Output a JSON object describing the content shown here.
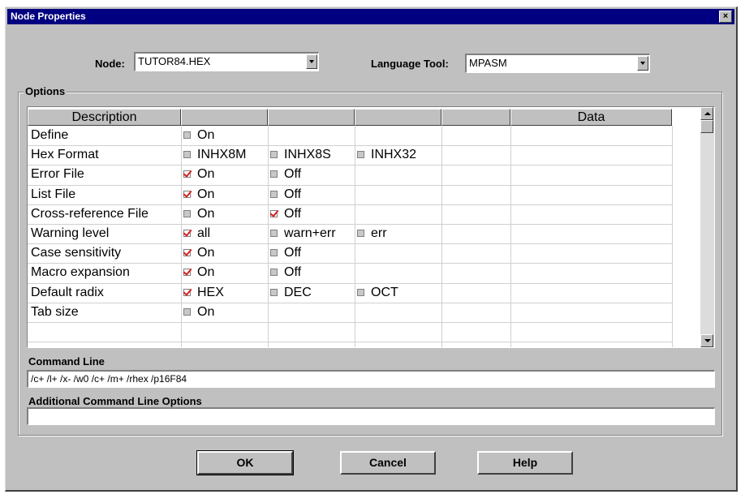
{
  "window": {
    "title": "Node Properties",
    "close_glyph": "×"
  },
  "node": {
    "label": "Node:",
    "value": "TUTOR84.HEX"
  },
  "language_tool": {
    "label": "Language Tool:",
    "value": "MPASM"
  },
  "options": {
    "group_label": "Options",
    "headers": [
      "Description",
      "",
      "",
      "",
      "Data"
    ],
    "rows": [
      {
        "description": "Define",
        "opts": [
          {
            "label": "On",
            "checked": false
          }
        ]
      },
      {
        "description": "Hex Format",
        "opts": [
          {
            "label": "INHX8M",
            "checked": false
          },
          {
            "label": "INHX8S",
            "checked": false
          },
          {
            "label": "INHX32",
            "checked": false
          }
        ]
      },
      {
        "description": "Error File",
        "opts": [
          {
            "label": "On",
            "checked": true
          },
          {
            "label": "Off",
            "checked": false
          }
        ]
      },
      {
        "description": "List File",
        "opts": [
          {
            "label": "On",
            "checked": true
          },
          {
            "label": "Off",
            "checked": false
          }
        ]
      },
      {
        "description": "Cross-reference File",
        "opts": [
          {
            "label": "On",
            "checked": false
          },
          {
            "label": "Off",
            "checked": true
          }
        ]
      },
      {
        "description": "Warning level",
        "opts": [
          {
            "label": "all",
            "checked": true
          },
          {
            "label": "warn+err",
            "checked": false
          },
          {
            "label": "err",
            "checked": false
          }
        ]
      },
      {
        "description": "Case sensitivity",
        "opts": [
          {
            "label": "On",
            "checked": true
          },
          {
            "label": "Off",
            "checked": false
          }
        ]
      },
      {
        "description": "Macro expansion",
        "opts": [
          {
            "label": "On",
            "checked": true
          },
          {
            "label": "Off",
            "checked": false
          }
        ]
      },
      {
        "description": "Default radix",
        "opts": [
          {
            "label": "HEX",
            "checked": true
          },
          {
            "label": "DEC",
            "checked": false
          },
          {
            "label": "OCT",
            "checked": false
          }
        ]
      },
      {
        "description": "Tab size",
        "opts": [
          {
            "label": "On",
            "checked": false
          }
        ]
      }
    ]
  },
  "command_line": {
    "label": "Command Line",
    "value": "/c+ /l+ /x- /w0 /c+ /m+ /rhex /p16F84"
  },
  "additional": {
    "label": "Additional Command Line Options",
    "value": ""
  },
  "buttons": {
    "ok": "OK",
    "cancel": "Cancel",
    "help": "Help"
  }
}
